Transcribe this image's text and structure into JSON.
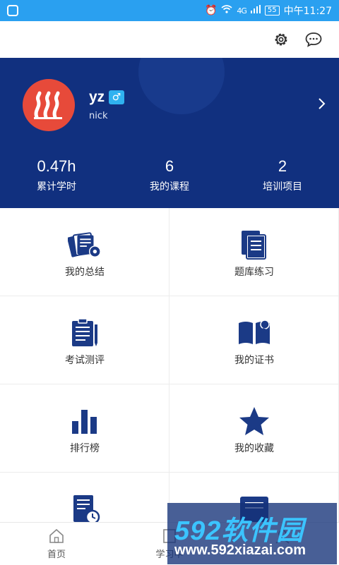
{
  "status_bar": {
    "network": "4G",
    "battery": "55",
    "time": "中午11:27"
  },
  "top_bar": {
    "icons": [
      "gear-icon",
      "message-icon"
    ]
  },
  "profile": {
    "username": "yz",
    "gender_symbol": "♂",
    "nickname": "nick",
    "stats": [
      {
        "value": "0.47h",
        "label": "累计学时"
      },
      {
        "value": "6",
        "label": "我的课程"
      },
      {
        "value": "2",
        "label": "培训项目"
      }
    ]
  },
  "menu": {
    "items": [
      {
        "label": "我的总结",
        "icon": "summary-icon"
      },
      {
        "label": "题库练习",
        "icon": "question-bank-icon"
      },
      {
        "label": "考试测评",
        "icon": "exam-icon"
      },
      {
        "label": "我的证书",
        "icon": "certificate-icon"
      },
      {
        "label": "排行榜",
        "icon": "ranking-icon"
      },
      {
        "label": "我的收藏",
        "icon": "star-icon"
      },
      {
        "label": "",
        "icon": "history-icon"
      },
      {
        "label": "",
        "icon": "notes-icon"
      }
    ]
  },
  "tab_bar": {
    "tabs": [
      {
        "label": "首页",
        "icon": "home-icon"
      },
      {
        "label": "学习中",
        "icon": "study-icon"
      },
      {
        "label": "",
        "icon": "profile-icon"
      }
    ]
  },
  "watermark": {
    "brand": "592软件园",
    "url": "www.592xiazai.com"
  },
  "colors": {
    "status_bar": "#2aa0f0",
    "profile_bg": "#11307f",
    "icon_navy": "#1b3a86",
    "avatar_bg": "#e74a3a",
    "gender_badge": "#2fb2f0"
  }
}
